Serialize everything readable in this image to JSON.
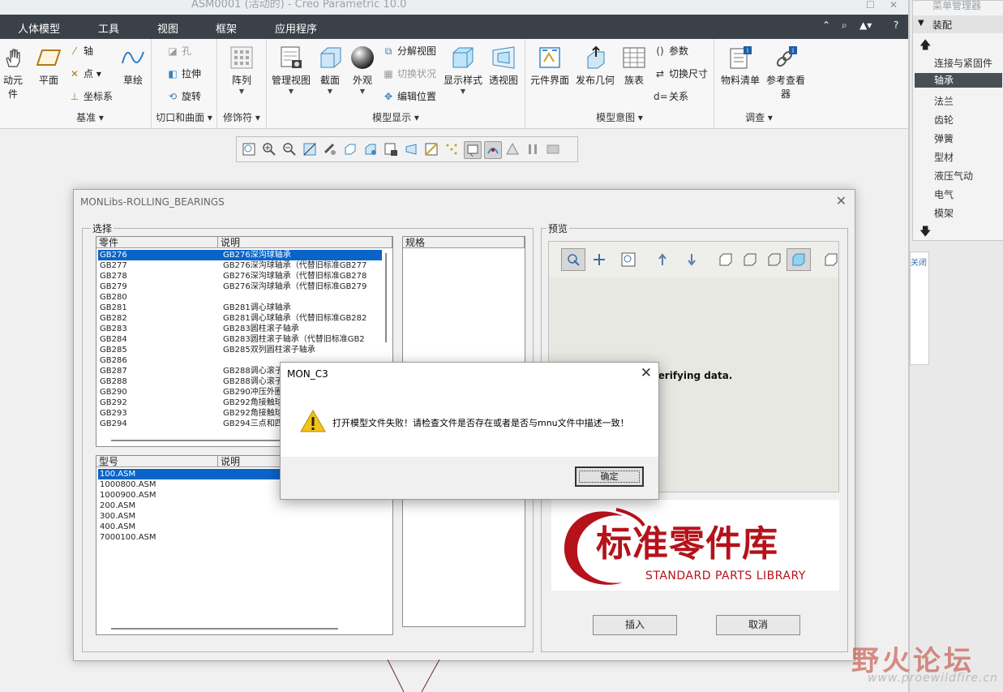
{
  "window": {
    "title": "ASM0001 (活动的) - Creo Parametric 10.0"
  },
  "menubar": {
    "items": [
      "人体模型",
      "工具",
      "视图",
      "框架",
      "应用程序"
    ]
  },
  "ribbon": {
    "row_partial_label": "动元件",
    "plane_label": "平面",
    "axis_label": "轴",
    "point_label": "点",
    "csys_label": "坐标系",
    "sketch_label": "草绘",
    "datum_group": "基准",
    "hole_label": "孔",
    "extrude_label": "拉伸",
    "revolve_label": "旋转",
    "cut_group": "切口和曲面",
    "pattern_label": "阵列",
    "modifier_group": "修饰符",
    "manage_views_label": "管理视图",
    "section_label": "截面",
    "appearance_label": "外观",
    "exploded_view_label": "分解视图",
    "toggle_status_label": "切换状况",
    "edit_position_label": "编辑位置",
    "display_style_label": "显示样式",
    "perspective_label": "透视图",
    "model_display_group": "模型显示",
    "component_interface_label": "元件界面",
    "publish_geometry_label": "发布几何",
    "family_table_label": "族表",
    "parameters_label": "参数",
    "switch_dims_label": "切换尺寸",
    "relations_label": "关系",
    "model_intent_group": "模型意图",
    "bom_label": "物料清单",
    "reference_viewer_label": "参考查看器",
    "investigate_group": "调查"
  },
  "menu_manager": {
    "header": "菜单管理器",
    "assembly": "装配",
    "items": [
      "连接与紧固件",
      "轴承",
      "法兰",
      "齿轮",
      "弹簧",
      "型材",
      "液压气动",
      "电气",
      "模架"
    ],
    "selected": "轴承",
    "side_label": "关闭"
  },
  "dialog": {
    "title": "MONLibs-ROLLING_BEARINGS",
    "select_label": "选择",
    "preview_label": "预览",
    "parts_list": {
      "headers": [
        "零件",
        "说明"
      ],
      "rows": [
        [
          "GB276",
          "GB276深沟球轴承"
        ],
        [
          "GB277",
          "GB276深沟球轴承（代替旧标准GB277"
        ],
        [
          "GB278",
          "GB276深沟球轴承（代替旧标准GB278"
        ],
        [
          "GB279",
          "GB276深沟球轴承（代替旧标准GB279"
        ],
        [
          "GB280",
          ""
        ],
        [
          "GB281",
          "GB281调心球轴承"
        ],
        [
          "GB282",
          "GB281调心球轴承（代替旧标准GB282"
        ],
        [
          "GB283",
          "GB283圆柱滚子轴承"
        ],
        [
          "GB284",
          "GB283圆柱滚子轴承（代替旧标准GB2"
        ],
        [
          "GB285",
          "GB285双列圆柱滚子轴承"
        ],
        [
          "GB286",
          ""
        ],
        [
          "GB287",
          "GB288调心滚子"
        ],
        [
          "GB288",
          "GB288调心滚子"
        ],
        [
          "GB290",
          "GB290冲压外圈"
        ],
        [
          "GB292",
          "GB292角接触球"
        ],
        [
          "GB293",
          "GB292角接触球"
        ],
        [
          "GB294",
          "GB294三点和四"
        ]
      ]
    },
    "spec_header": "规格",
    "model_list": {
      "headers": [
        "型号",
        "说明"
      ],
      "rows": [
        "100.ASM",
        "1000800.ASM",
        "1000900.ASM",
        "200.ASM",
        "300.ASM",
        "400.ASM",
        "7000100.ASM"
      ]
    },
    "verify_text": "Verifying data.",
    "logo_cn": "标准零件库",
    "logo_en": "STANDARD PARTS LIBRARY",
    "insert_button": "插入",
    "cancel_button": "取消"
  },
  "message_box": {
    "title": "MON_C3",
    "text": "打开模型文件失败！请检查文件是否存在或者是否与mnu文件中描述一致！",
    "ok": "确定"
  },
  "watermark": {
    "cn": "野火论坛",
    "url": "www.proewildfire.cn"
  }
}
